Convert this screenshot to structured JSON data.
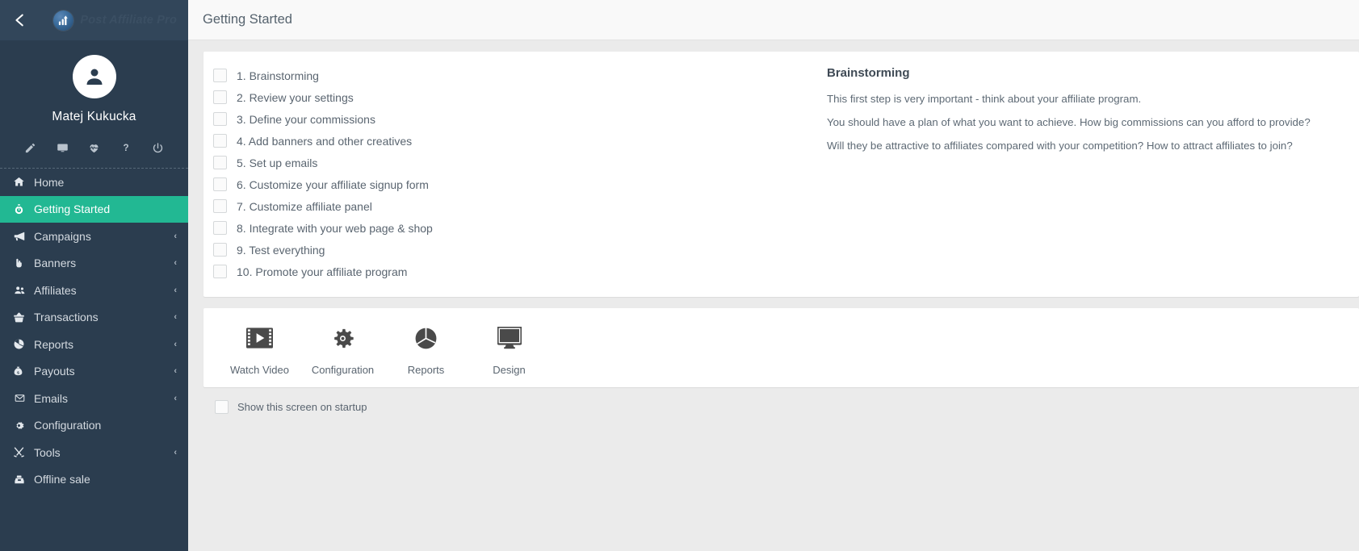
{
  "sidebar": {
    "back_icon": "chevron-left-icon",
    "brand": {
      "name": "Post Affiliate Pro",
      "logo_icon": "bar-chart-logo-icon"
    },
    "profile": {
      "avatar_icon": "user-avatar-icon",
      "user_name": "Matej Kukucka"
    },
    "tools": [
      {
        "name": "edit-icon",
        "label": "Edit"
      },
      {
        "name": "desktop-icon",
        "label": "Desktop"
      },
      {
        "name": "heartbeat-icon",
        "label": "Health"
      },
      {
        "name": "question-icon",
        "label": "Help"
      },
      {
        "name": "power-icon",
        "label": "Logout"
      }
    ],
    "items": [
      {
        "label": "Home",
        "icon": "home-icon",
        "chevron": "",
        "active": false
      },
      {
        "label": "Getting Started",
        "icon": "rocket-icon",
        "chevron": "",
        "active": true
      },
      {
        "label": "Campaigns",
        "icon": "megaphone-icon",
        "chevron": "‹",
        "active": false
      },
      {
        "label": "Banners",
        "icon": "hand-pointer-icon",
        "chevron": "‹",
        "active": false
      },
      {
        "label": "Affiliates",
        "icon": "users-icon",
        "chevron": "‹",
        "active": false
      },
      {
        "label": "Transactions",
        "icon": "basket-icon",
        "chevron": "‹",
        "active": false
      },
      {
        "label": "Reports",
        "icon": "pie-chart-icon",
        "chevron": "‹",
        "active": false
      },
      {
        "label": "Payouts",
        "icon": "money-bag-icon",
        "chevron": "‹",
        "active": false
      },
      {
        "label": "Emails",
        "icon": "envelope-icon",
        "chevron": "‹",
        "active": false
      },
      {
        "label": "Configuration",
        "icon": "gear-icon",
        "chevron": "",
        "active": false
      },
      {
        "label": "Tools",
        "icon": "tools-icon",
        "chevron": "‹",
        "active": false
      },
      {
        "label": "Offline sale",
        "icon": "cash-register-icon",
        "chevron": "",
        "active": false
      }
    ]
  },
  "header": {
    "title": "Getting Started"
  },
  "checklist": {
    "items": [
      {
        "label": "1. Brainstorming",
        "checked": false
      },
      {
        "label": "2. Review your settings",
        "checked": false
      },
      {
        "label": "3. Define your commissions",
        "checked": false
      },
      {
        "label": "4. Add banners and other creatives",
        "checked": false
      },
      {
        "label": "5. Set up emails",
        "checked": false
      },
      {
        "label": "6. Customize your affiliate signup form",
        "checked": false
      },
      {
        "label": "7. Customize affiliate panel",
        "checked": false
      },
      {
        "label": "8. Integrate with your web page & shop",
        "checked": false
      },
      {
        "label": "9. Test everything",
        "checked": false
      },
      {
        "label": "10. Promote your affiliate program",
        "checked": false
      }
    ]
  },
  "detail": {
    "title": "Brainstorming",
    "paragraphs": [
      "This first step is very important - think about your affiliate program.",
      "You should have a plan of what you want to achieve. How big commissions can you afford to provide?",
      "Will they be attractive to affiliates compared with your competition? How to attract affiliates to join?"
    ]
  },
  "shortcuts": [
    {
      "label": "Watch Video",
      "icon": "film-play-icon"
    },
    {
      "label": "Configuration",
      "icon": "gear-icon"
    },
    {
      "label": "Reports",
      "icon": "pie-chart-icon"
    },
    {
      "label": "Design",
      "icon": "desktop-monitor-icon"
    }
  ],
  "startup": {
    "label": "Show this screen on startup",
    "checked": false
  },
  "colors": {
    "accent_green": "#22b893",
    "sidebar_bg": "#2b3d4f",
    "sidebar_top_bg": "#32465a",
    "page_bg": "#ebebeb",
    "panel_bg": "#ffffff",
    "text_muted": "#5a6570"
  }
}
